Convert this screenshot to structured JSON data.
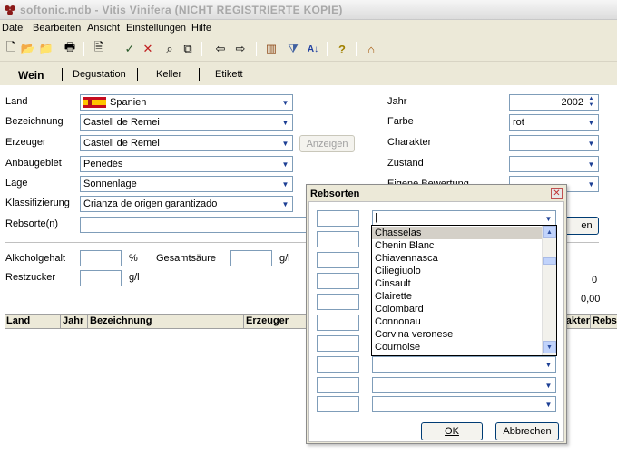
{
  "window": {
    "title": "softonic.mdb - Vitis Vinifera (NICHT REGISTRIERTE KOPIE)"
  },
  "menu": [
    "Datei",
    "Bearbeiten",
    "Ansicht",
    "Einstellungen",
    "Hilfe"
  ],
  "tabs": [
    "Wein",
    "Degustation",
    "Keller",
    "Etikett"
  ],
  "form": {
    "land_label": "Land",
    "land_value": "Spanien",
    "bezeichnung_label": "Bezeichnung",
    "bezeichnung_value": "Castell de Remei",
    "erzeuger_label": "Erzeuger",
    "erzeuger_value": "Castell de Remei",
    "anzeigen_label": "Anzeigen",
    "anbaugebiet_label": "Anbaugebiet",
    "anbaugebiet_value": "Penedés",
    "lage_label": "Lage",
    "lage_value": "Sonnenlage",
    "klassifizierung_label": "Klassifizierung",
    "klassifizierung_value": "Crianza de origen garantizado",
    "rebsorten_label": "Rebsorte(n)",
    "rebsorten_button_partial": "en",
    "jahr_label": "Jahr",
    "jahr_value": "2002",
    "farbe_label": "Farbe",
    "farbe_value": "rot",
    "charakter_label": "Charakter",
    "zustand_label": "Zustand",
    "bewertung_label": "Eigene Bewertung",
    "alkohol_label": "Alkoholgehalt",
    "alkohol_unit": "%",
    "saeure_label": "Gesamtsäure",
    "saeure_unit": "g/l",
    "restzucker_label": "Restzucker",
    "restzucker_unit": "g/l",
    "value_zero": "0",
    "value_price": "0,00"
  },
  "grid": {
    "columns": [
      "Land",
      "Jahr",
      "Bezeichnung",
      "Erzeuger",
      "Charakter",
      "Rebs"
    ]
  },
  "dialog": {
    "title": "Rebsorten",
    "close": "✕",
    "ok_label": "OK",
    "cancel_label": "Abbrechen",
    "dropdown_items": [
      "Chasselas",
      "Chenin Blanc",
      "Chiavennasca",
      "Ciliegiuolo",
      "Cinsault",
      "Clairette",
      "Colombard",
      "Connonau",
      "Corvina veronese",
      "Cournoise"
    ]
  },
  "colors": {
    "accent": "#1c3f94",
    "selection": "#d4d0c8",
    "border": "#7f9db9"
  }
}
